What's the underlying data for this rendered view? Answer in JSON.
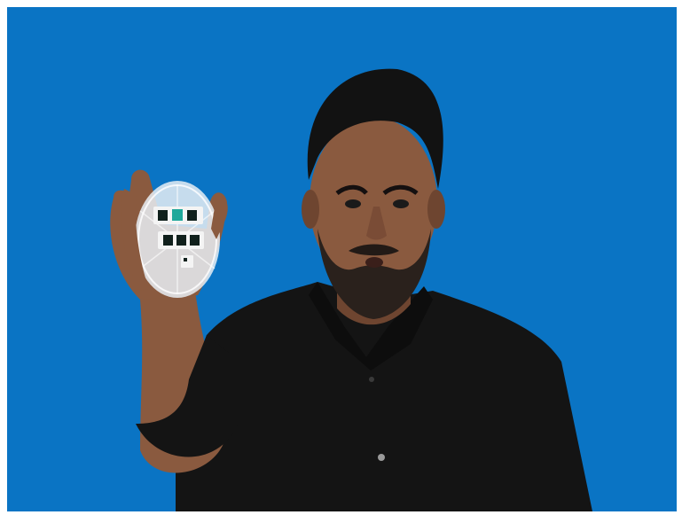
{
  "scene": {
    "description_free": true,
    "colors": {
      "backdrop": "#0a74c4",
      "shirt": "#141414",
      "skin": "#8a5a3f",
      "skin_dark": "#6e4530",
      "hair": "#121212",
      "beard": "#2a211c",
      "dish": "#e8eef4",
      "sample_light": "#f4f4f4",
      "sample_dark": "#10201c",
      "sample_green": "#1fa89a"
    },
    "icons": [
      "video-frame",
      "person",
      "petri-dish",
      "sample-chips"
    ]
  }
}
